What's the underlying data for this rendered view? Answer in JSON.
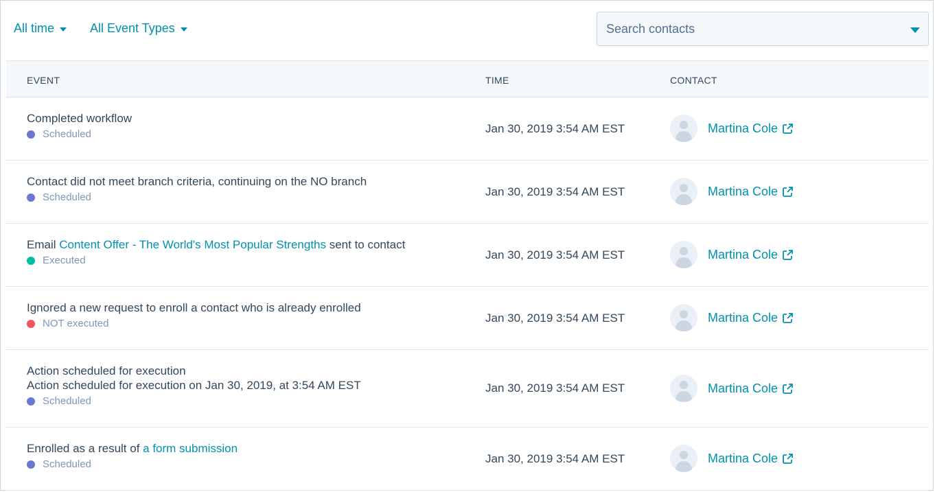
{
  "filters": {
    "time": "All time",
    "event_types": "All Event Types"
  },
  "search": {
    "placeholder": "Search contacts"
  },
  "columns": {
    "event": "EVENT",
    "time": "TIME",
    "contact": "CONTACT"
  },
  "status_colors": {
    "Scheduled": "#6a78d1",
    "Executed": "#00bda5",
    "NOT executed": "#f2545b"
  },
  "rows": [
    {
      "event_line1": "Completed workflow",
      "status": "Scheduled",
      "time": "Jan 30, 2019 3:54 AM EST",
      "contact": "Martina Cole"
    },
    {
      "event_line1": "Contact did not meet branch criteria, continuing on the NO branch",
      "status": "Scheduled",
      "time": "Jan 30, 2019 3:54 AM EST",
      "contact": "Martina Cole"
    },
    {
      "event_prefix": "Email ",
      "event_link": "Content Offer - The World's Most Popular Strengths",
      "event_suffix": " sent to contact",
      "status": "Executed",
      "time": "Jan 30, 2019 3:54 AM EST",
      "contact": "Martina Cole"
    },
    {
      "event_line1": "Ignored a new request to enroll a contact who is already enrolled",
      "status": "NOT executed",
      "time": "Jan 30, 2019 3:54 AM EST",
      "contact": "Martina Cole"
    },
    {
      "event_line1": "Action scheduled for execution",
      "event_line2": "Action scheduled for execution on Jan 30, 2019, at 3:54 AM EST",
      "status": "Scheduled",
      "time": "Jan 30, 2019 3:54 AM EST",
      "contact": "Martina Cole"
    },
    {
      "event_prefix": "Enrolled as a result of ",
      "event_link": "a form submission",
      "status": "Scheduled",
      "time": "Jan 30, 2019 3:54 AM EST",
      "contact": "Martina Cole"
    }
  ]
}
